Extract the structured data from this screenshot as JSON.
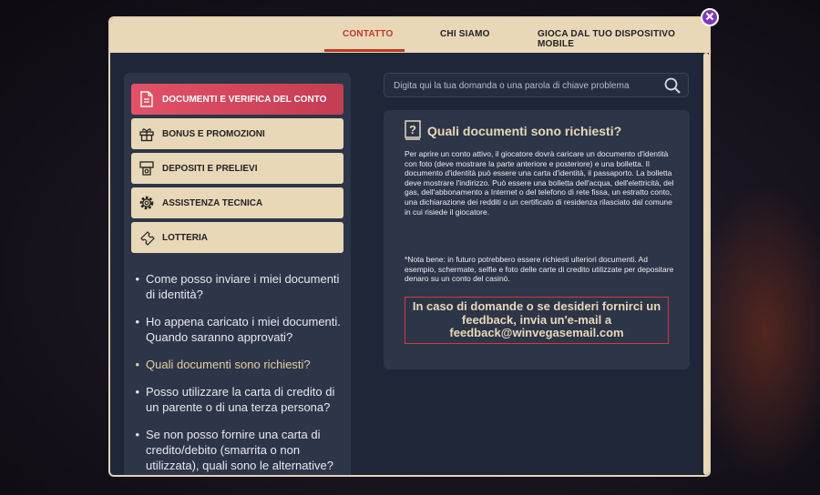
{
  "tabs": [
    {
      "label": "CONTATTO"
    },
    {
      "label": "CHI SIAMO"
    },
    {
      "label": "GIOCA DAL TUO DISPOSITIVO MOBILE"
    }
  ],
  "categories": [
    {
      "label": "DOCUMENTI E VERIFICA DEL CONTO",
      "icon": "document-icon"
    },
    {
      "label": "BONUS E PROMOZIONI",
      "icon": "gift-icon"
    },
    {
      "label": "DEPOSITI E PRELIEVI",
      "icon": "atm-icon"
    },
    {
      "label": "ASSISTENZA TECNICA",
      "icon": "gear-icon"
    },
    {
      "label": "LOTTERIA",
      "icon": "ticket-icon"
    }
  ],
  "faq": [
    "Come posso inviare i miei documenti di identità?",
    "Ho appena caricato i miei documenti. Quando saranno approvati?",
    "Quali documenti sono richiesti?",
    "Posso utilizzare la carta di credito di un parente o di una terza persona?",
    "Se non posso fornire una carta di credito/debito (smarrita o non utilizzata), quali sono le alternative?"
  ],
  "search": {
    "placeholder": "Digita qui la tua domanda o una parola di chiave problema"
  },
  "article": {
    "title": "Quali documenti sono richiesti?",
    "body": "Per aprire un conto attivo, il giocatore dovrà caricare un documento d'identità con foto (deve mostrare la parte anteriore e posteriore) e una bolletta. Il documento d'identità può essere una carta d'identità, il passaporto. La bolletta deve mostrare l'indirizzo. Può essere una bolletta dell'acqua, dell'elettricità, del gas, dell'abbonamento a Internet o del telefono di rete fissa, un estratto conto, una dichiarazione dei redditi o un certificato di residenza rilasciato dal comune in cui risiede il giocatore.",
    "note": "*Nota bene: in futuro potrebbero essere richiesti ulteriori documenti. Ad esempio, schermate, selfie e foto delle carte di credito utilizzate per depositare denaro su un conto del casinò.",
    "contact": "In caso di domande o se desideri fornirci un feedback, invia un'e-mail a feedback@winvegasemail.com"
  },
  "colors": {
    "accent": "#c0392b",
    "tab_bg": "#e8d8b8",
    "active_category": "#e25168",
    "panel_bg": "#2d3548",
    "modal_bg": "#1f2638",
    "close_button": "#7d3ab8"
  }
}
